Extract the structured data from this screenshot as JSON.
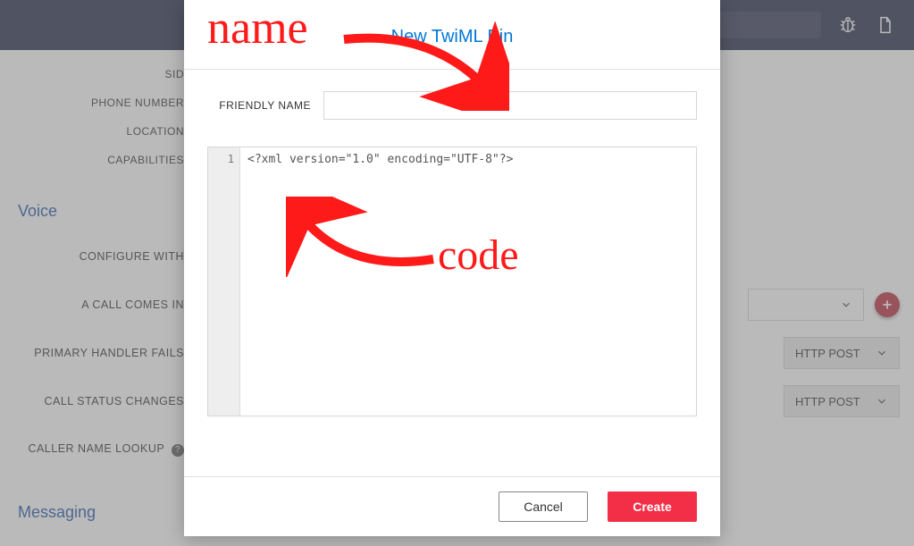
{
  "topbar": {
    "search_placeholder": ""
  },
  "bg": {
    "top_labels": [
      "SID",
      "PHONE NUMBER",
      "LOCATION",
      "CAPABILITIES"
    ],
    "section_voice": "Voice",
    "section_messaging": "Messaging",
    "rows": {
      "configure_with": "CONFIGURE WITH",
      "call_comes_in": "A CALL COMES IN",
      "primary_handler_fails": "PRIMARY HANDLER FAILS",
      "call_status_changes": "CALL STATUS CHANGES",
      "caller_name_lookup": "CALLER NAME LOOKUP"
    },
    "http_method": "HTTP POST"
  },
  "modal": {
    "title": "New TwiML Bin",
    "friendly_name_label": "FRIENDLY NAME",
    "friendly_name_value": "",
    "code_line_number": "1",
    "code_content": "<?xml version=\"1.0\" encoding=\"UTF-8\"?>",
    "cancel_label": "Cancel",
    "create_label": "Create"
  },
  "annotations": {
    "name": "name",
    "code": "code"
  }
}
